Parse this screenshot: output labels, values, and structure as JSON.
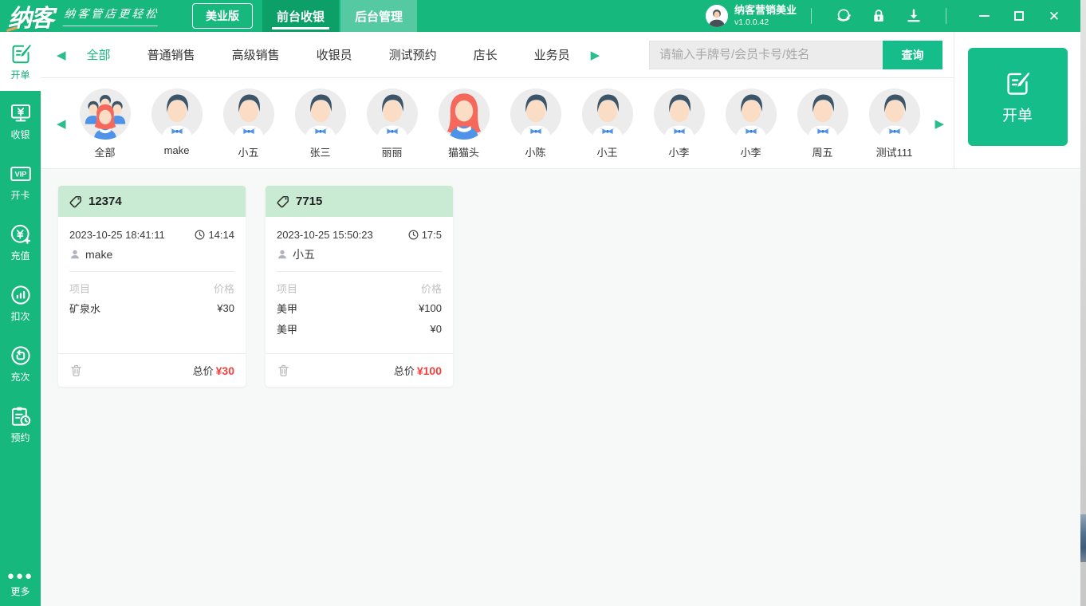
{
  "titlebar": {
    "logo_text": "纳客",
    "slogan": "纳客管店更轻松",
    "edition_badge": "美业版",
    "nav_tabs": [
      {
        "label": "前台收银",
        "active": true
      },
      {
        "label": "后台管理",
        "active": false
      }
    ],
    "account": {
      "name": "纳客营销美业",
      "version": "v1.0.0.42"
    },
    "icons": [
      "service-icon",
      "lock-icon",
      "download-icon"
    ],
    "window_controls": [
      "minimize",
      "maximize",
      "close"
    ]
  },
  "sidebar": {
    "items": [
      {
        "label": "开单",
        "icon": "order",
        "active": true
      },
      {
        "label": "收银",
        "icon": "cashier",
        "active": false
      },
      {
        "label": "开卡",
        "icon": "vip",
        "icon_text": "VIP",
        "active": false
      },
      {
        "label": "充值",
        "icon": "recharge",
        "active": false
      },
      {
        "label": "扣次",
        "icon": "deduct",
        "active": false
      },
      {
        "label": "充次",
        "icon": "refill",
        "active": false
      },
      {
        "label": "预约",
        "icon": "booking",
        "active": false
      }
    ],
    "more_label": "更多"
  },
  "filters": {
    "tabs": [
      {
        "label": "全部",
        "active": true
      },
      {
        "label": "普通销售",
        "active": false
      },
      {
        "label": "高级销售",
        "active": false
      },
      {
        "label": "收银员",
        "active": false
      },
      {
        "label": "测试预约",
        "active": false
      },
      {
        "label": "店长",
        "active": false
      },
      {
        "label": "业务员",
        "active": false
      }
    ]
  },
  "search": {
    "placeholder": "请输入手牌号/会员卡号/姓名",
    "button_label": "查询"
  },
  "new_order": {
    "label": "开单"
  },
  "staff": [
    {
      "name": "全部",
      "type": "group"
    },
    {
      "name": "make",
      "type": "male"
    },
    {
      "name": "小五",
      "type": "male"
    },
    {
      "name": "张三",
      "type": "male"
    },
    {
      "name": "丽丽",
      "type": "male"
    },
    {
      "name": "猫猫头",
      "type": "female"
    },
    {
      "name": "小陈",
      "type": "male"
    },
    {
      "name": "小王",
      "type": "male"
    },
    {
      "name": "小李",
      "type": "male"
    },
    {
      "name": "小李",
      "type": "male"
    },
    {
      "name": "周五",
      "type": "male"
    },
    {
      "name": "测试111",
      "type": "male"
    }
  ],
  "orders_columns": {
    "item": "项目",
    "price": "价格"
  },
  "orders": [
    {
      "id": "12374",
      "datetime": "2023-10-25 18:41:11",
      "duration": "14:14",
      "member": "make",
      "items": [
        {
          "name": "矿泉水",
          "price": "¥30"
        }
      ],
      "total_label": "总价",
      "total": "¥30"
    },
    {
      "id": "7715",
      "datetime": "2023-10-25 15:50:23",
      "duration": "17:5",
      "member": "小五",
      "items": [
        {
          "name": "美甲",
          "price": "¥100"
        },
        {
          "name": "美甲",
          "price": "¥0"
        }
      ],
      "total_label": "总价",
      "total": "¥100"
    }
  ],
  "colors": {
    "brand_green": "#17b87e",
    "active_tab_green": "#0d9f68",
    "card_header_green": "#c9ead3",
    "price_red": "#f5413d"
  }
}
